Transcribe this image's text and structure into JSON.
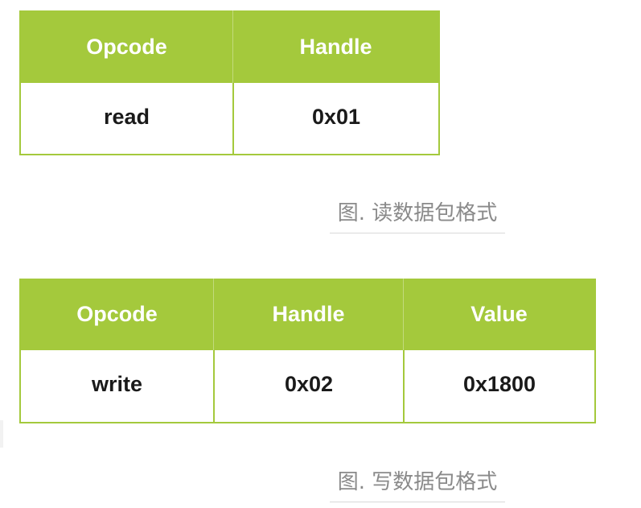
{
  "read_table": {
    "headers": [
      "Opcode",
      "Handle"
    ],
    "row": [
      "read",
      "0x01"
    ],
    "caption": "图. 读数据包格式"
  },
  "write_table": {
    "headers": [
      "Opcode",
      "Handle",
      "Value"
    ],
    "row": [
      "write",
      "0x02",
      "0x1800"
    ],
    "caption": "图. 写数据包格式"
  },
  "colors": {
    "header_bg": "#a4c93c",
    "header_text": "#ffffff",
    "cell_text": "#1a1a1a",
    "caption_text": "#8a8a8a"
  }
}
